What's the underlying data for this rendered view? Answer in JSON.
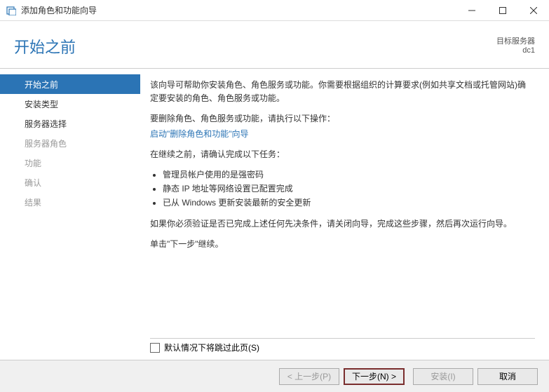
{
  "window": {
    "title": "添加角色和功能向导"
  },
  "header": {
    "title": "开始之前",
    "target_label": "目标服务器",
    "target_value": "dc1"
  },
  "sidebar": {
    "items": [
      "开始之前",
      "安装类型",
      "服务器选择",
      "服务器角色",
      "功能",
      "确认",
      "结果"
    ]
  },
  "main": {
    "intro": "该向导可帮助你安装角色、角色服务或功能。你需要根据组织的计算要求(例如共享文档或托管网站)确定要安装的角色、角色服务或功能。",
    "remove_prefix": "要删除角色、角色服务或功能，请执行以下操作：",
    "remove_link": "启动\"删除角色和功能\"向导",
    "continue_prefix": "在继续之前，请确认完成以下任务：",
    "bullets": [
      "管理员帐户使用的是强密码",
      "静态 IP 地址等网络设置已配置完成",
      "已从 Windows 更新安装最新的安全更新"
    ],
    "verify": "如果你必须验证是否已完成上述任何先决条件，请关闭向导，完成这些步骤，然后再次运行向导。",
    "next_hint": "单击\"下一步\"继续。"
  },
  "skip": {
    "label": "默认情况下将跳过此页(S)"
  },
  "footer": {
    "prev": "< 上一步(P)",
    "next": "下一步(N) >",
    "install": "安装(I)",
    "cancel": "取消"
  }
}
